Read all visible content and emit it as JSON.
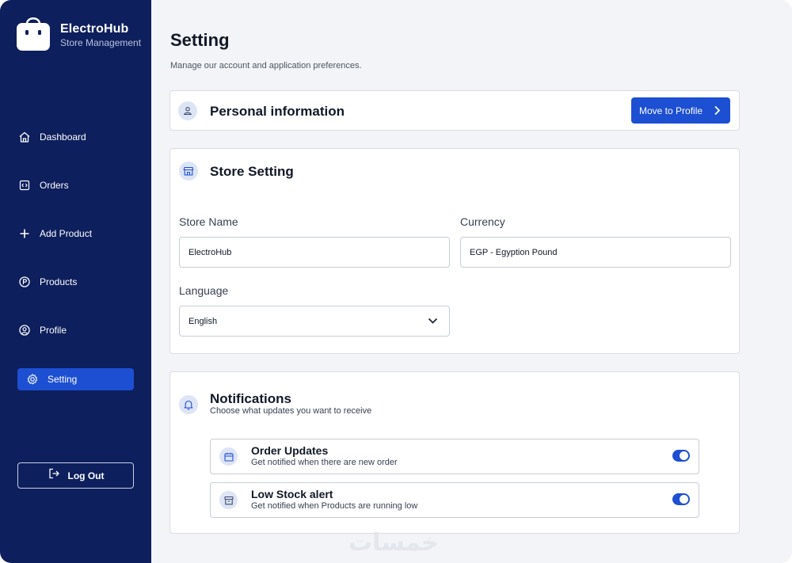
{
  "brand": {
    "name": "ElectroHub",
    "subtitle": "Store Management"
  },
  "sidebar": {
    "items": [
      {
        "label": "Dashboard",
        "icon": "home-icon",
        "active": false
      },
      {
        "label": "Orders",
        "icon": "orders-icon",
        "active": false
      },
      {
        "label": "Add Product",
        "icon": "plus-icon",
        "active": false
      },
      {
        "label": "Products",
        "icon": "products-icon",
        "active": false
      },
      {
        "label": "Profile",
        "icon": "user-circle-icon",
        "active": false
      },
      {
        "label": "Setting",
        "icon": "gear-icon",
        "active": true
      }
    ],
    "logout_label": "Log Out"
  },
  "page": {
    "title": "Setting",
    "subtitle": "Manage our account and application preferences."
  },
  "personal": {
    "title": "Personal information",
    "button_label": "Move to Profile"
  },
  "store": {
    "title": "Store Setting",
    "store_name_label": "Store Name",
    "store_name_value": "ElectroHub",
    "currency_label": "Currency",
    "currency_value": "EGP - Egyption Pound",
    "language_label": "Language",
    "language_value": "English"
  },
  "notifications": {
    "title": "Notifications",
    "subtitle": "Choose what updates you want to receive",
    "items": [
      {
        "title": "Order Updates",
        "description": "Get notified when there are new order",
        "enabled": true
      },
      {
        "title": "Low Stock alert",
        "description": "Get notified when Products are running low",
        "enabled": true
      }
    ]
  },
  "watermark": "خمسات",
  "colors": {
    "sidebar": "#0d1f5c",
    "accent": "#1d4fd3",
    "background": "#f3f4f7"
  }
}
